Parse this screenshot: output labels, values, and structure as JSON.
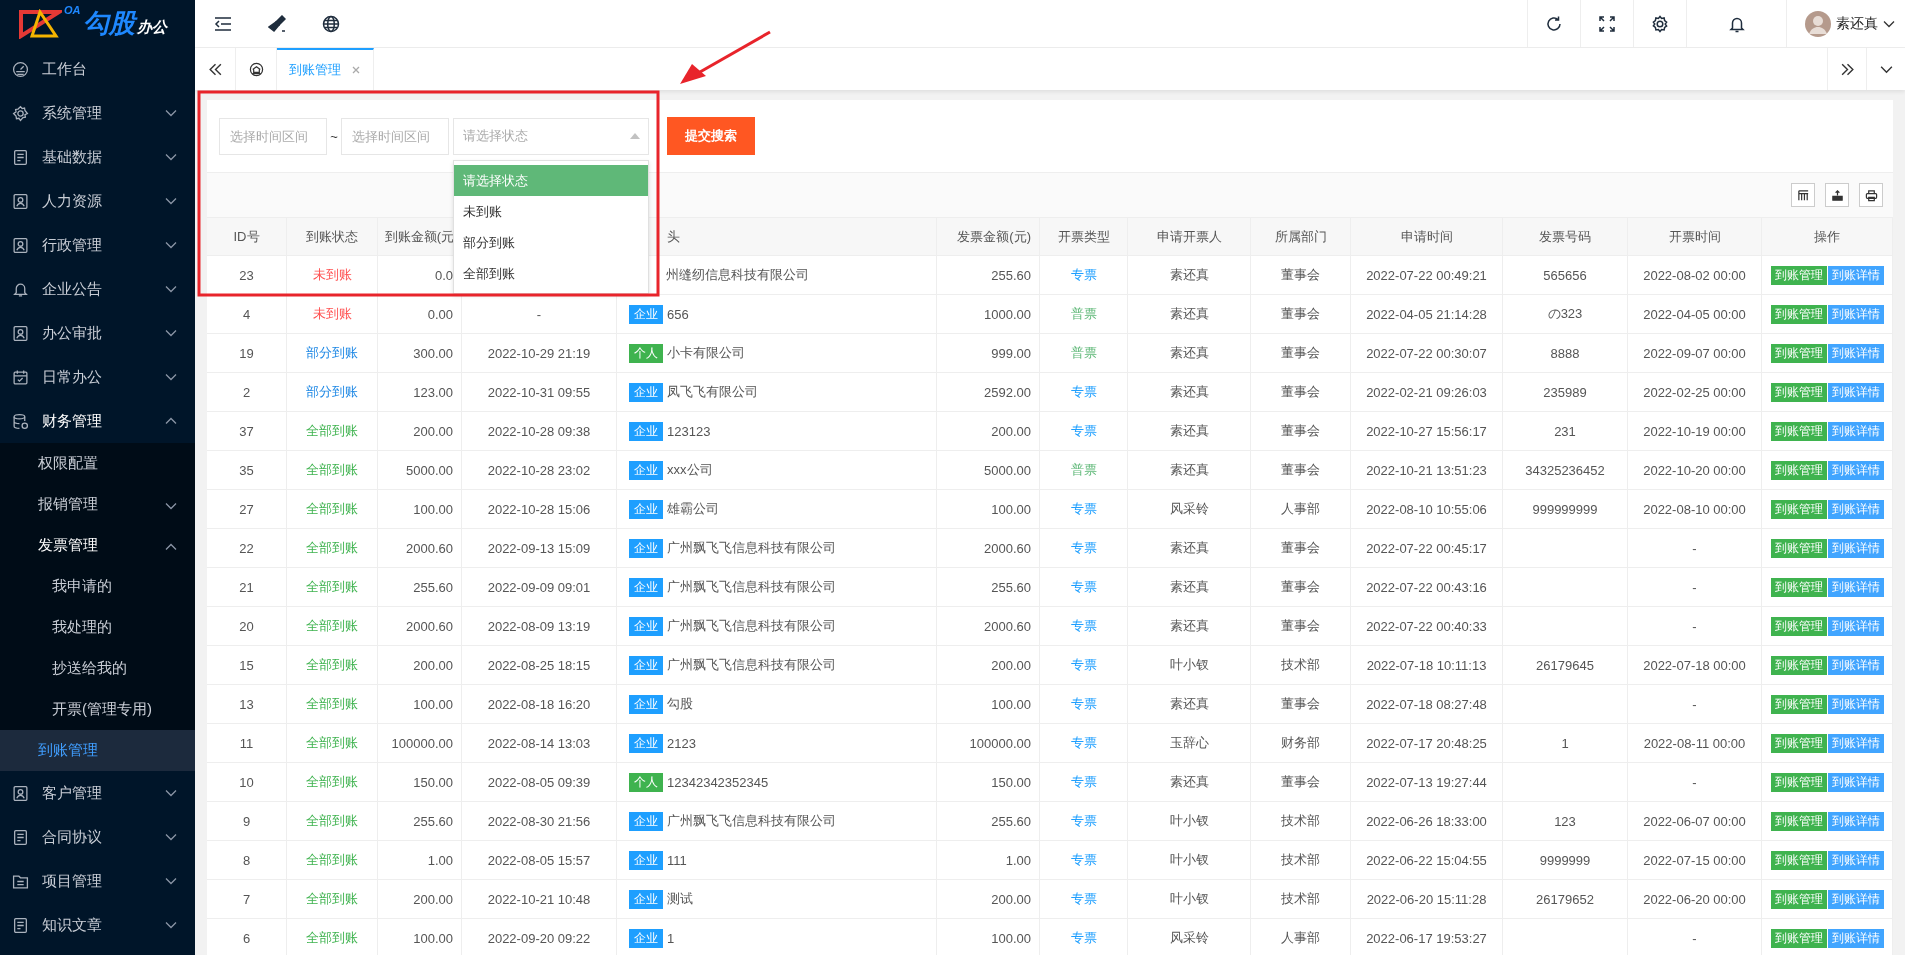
{
  "sidebar": {
    "logo": {
      "badge": "OA",
      "name": "勾股",
      "suffix": "办公"
    },
    "items": [
      {
        "label": "工作台",
        "selected": false
      },
      {
        "label": "系统管理",
        "selected": false,
        "expanded": false
      },
      {
        "label": "基础数据",
        "selected": false,
        "expanded": false
      },
      {
        "label": "人力资源",
        "selected": false,
        "expanded": false
      },
      {
        "label": "行政管理",
        "selected": false,
        "expanded": false
      },
      {
        "label": "企业公告",
        "selected": false,
        "expanded": false
      },
      {
        "label": "办公审批",
        "selected": false,
        "expanded": false
      },
      {
        "label": "日常办公",
        "selected": false,
        "expanded": false
      },
      {
        "label": "财务管理",
        "selected": false,
        "expanded": true,
        "children": [
          {
            "label": "权限配置",
            "selected": false
          },
          {
            "label": "报销管理",
            "selected": false,
            "expanded": false
          },
          {
            "label": "发票管理",
            "selected": false,
            "expanded": true,
            "children": [
              {
                "label": "我申请的",
                "selected": false
              },
              {
                "label": "我处理的",
                "selected": false
              },
              {
                "label": "抄送给我的",
                "selected": false
              },
              {
                "label": "开票(管理专用)",
                "selected": false
              }
            ]
          },
          {
            "label": "到账管理",
            "selected": true
          }
        ]
      },
      {
        "label": "客户管理",
        "selected": false,
        "expanded": false
      },
      {
        "label": "合同协议",
        "selected": false,
        "expanded": false
      },
      {
        "label": "项目管理",
        "selected": false,
        "expanded": false
      },
      {
        "label": "知识文章",
        "selected": false,
        "expanded": false
      }
    ]
  },
  "header": {
    "user": "素还真"
  },
  "tabs": [
    {
      "label": "到账管理",
      "selected": true
    }
  ],
  "search": {
    "start_placeholder": "选择时间区间",
    "separator": "~",
    "end_placeholder": "选择时间区间",
    "status_placeholder": "请选择状态",
    "submit": "提交搜索",
    "options": [
      {
        "label": "请选择状态",
        "selected": true
      },
      {
        "label": "未到账",
        "selected": false
      },
      {
        "label": "部分到账",
        "selected": false
      },
      {
        "label": "全部到账",
        "selected": false
      }
    ]
  },
  "table": {
    "columns_left": [
      "ID号",
      "到账状态",
      "到账金额(元"
    ],
    "columns_right": [
      "头",
      "发票金额(元)",
      "开票类型",
      "申请开票人",
      "所属部门",
      "申请时间",
      "发票号码",
      "开票时间",
      "操作"
    ],
    "rows": [
      {
        "id": "23",
        "status": {
          "text": "未到账",
          "color": "#ff5252"
        },
        "amount": "0.0",
        "title": "州缝纫信息科技有限公司",
        "invoice_amount": "255.60",
        "invoice_type": {
          "text": "专票",
          "color": "#1e9fff"
        },
        "applicant": "素还真",
        "department": "董事会",
        "apply_time": "2022-07-22 00:49:21",
        "invoice_no": "565656",
        "invoice_time": "2022-08-02 00:00",
        "actions": [
          "到账管理",
          "到账详情"
        ]
      },
      {
        "id": "4",
        "status": {
          "text": "未到账",
          "color": "#ff5252"
        },
        "amount": "0.00",
        "arrival_time": "-",
        "tag": {
          "text": "企业",
          "color": "#1e9fff"
        },
        "title": "656",
        "invoice_amount": "1000.00",
        "invoice_type": {
          "text": "普票",
          "color": "#5fb878"
        },
        "applicant": "素还真",
        "department": "董事会",
        "apply_time": "2022-04-05 21:14:28",
        "invoice_no": "の323",
        "invoice_time": "2022-04-05 00:00",
        "actions": [
          "到账管理",
          "到账详情"
        ]
      },
      {
        "id": "19",
        "status": {
          "text": "部分到账",
          "color": "#1e88e5"
        },
        "amount": "300.00",
        "arrival_time": "2022-10-29 21:19",
        "tag": {
          "text": "个人",
          "color": "#3fb34f"
        },
        "title": "小卡有限公司",
        "invoice_amount": "999.00",
        "invoice_type": {
          "text": "普票",
          "color": "#5fb878"
        },
        "applicant": "素还真",
        "department": "董事会",
        "apply_time": "2022-07-22 00:30:07",
        "invoice_no": "8888",
        "invoice_time": "2022-09-07 00:00",
        "actions": [
          "到账管理",
          "到账详情"
        ]
      },
      {
        "id": "2",
        "status": {
          "text": "部分到账",
          "color": "#1e88e5"
        },
        "amount": "123.00",
        "arrival_time": "2022-10-31 09:55",
        "tag": {
          "text": "企业",
          "color": "#1e9fff"
        },
        "title": "凤飞飞有限公司",
        "invoice_amount": "2592.00",
        "invoice_type": {
          "text": "专票",
          "color": "#1e9fff"
        },
        "applicant": "素还真",
        "department": "董事会",
        "apply_time": "2022-02-21 09:26:03",
        "invoice_no": "235989",
        "invoice_time": "2022-02-25 00:00",
        "actions": [
          "到账管理",
          "到账详情"
        ]
      },
      {
        "id": "37",
        "status": {
          "text": "全部到账",
          "color": "#3fb34f"
        },
        "amount": "200.00",
        "arrival_time": "2022-10-28 09:38",
        "tag": {
          "text": "企业",
          "color": "#1e9fff"
        },
        "title": "123123",
        "invoice_amount": "200.00",
        "invoice_type": {
          "text": "专票",
          "color": "#1e9fff"
        },
        "applicant": "素还真",
        "department": "董事会",
        "apply_time": "2022-10-27 15:56:17",
        "invoice_no": "231",
        "invoice_time": "2022-10-19 00:00",
        "actions": [
          "到账管理",
          "到账详情"
        ]
      },
      {
        "id": "35",
        "status": {
          "text": "全部到账",
          "color": "#3fb34f"
        },
        "amount": "5000.00",
        "arrival_time": "2022-10-28 23:02",
        "tag": {
          "text": "企业",
          "color": "#1e9fff"
        },
        "title": "xxx公司",
        "invoice_amount": "5000.00",
        "invoice_type": {
          "text": "普票",
          "color": "#5fb878"
        },
        "applicant": "素还真",
        "department": "董事会",
        "apply_time": "2022-10-21 13:51:23",
        "invoice_no": "34325236452",
        "invoice_time": "2022-10-20 00:00",
        "actions": [
          "到账管理",
          "到账详情"
        ]
      },
      {
        "id": "27",
        "status": {
          "text": "全部到账",
          "color": "#3fb34f"
        },
        "amount": "100.00",
        "arrival_time": "2022-10-28 15:06",
        "tag": {
          "text": "企业",
          "color": "#1e9fff"
        },
        "title": "雄霸公司",
        "invoice_amount": "100.00",
        "invoice_type": {
          "text": "专票",
          "color": "#1e9fff"
        },
        "applicant": "风采铃",
        "department": "人事部",
        "apply_time": "2022-08-10 10:55:06",
        "invoice_no": "999999999",
        "invoice_time": "2022-08-10 00:00",
        "actions": [
          "到账管理",
          "到账详情"
        ]
      },
      {
        "id": "22",
        "status": {
          "text": "全部到账",
          "color": "#3fb34f"
        },
        "amount": "2000.60",
        "arrival_time": "2022-09-13 15:09",
        "tag": {
          "text": "企业",
          "color": "#1e9fff"
        },
        "title": "广州飘飞飞信息科技有限公司",
        "invoice_amount": "2000.60",
        "invoice_type": {
          "text": "专票",
          "color": "#1e9fff"
        },
        "applicant": "素还真",
        "department": "董事会",
        "apply_time": "2022-07-22 00:45:17",
        "invoice_time": "-",
        "actions": [
          "到账管理",
          "到账详情"
        ]
      },
      {
        "id": "21",
        "status": {
          "text": "全部到账",
          "color": "#3fb34f"
        },
        "amount": "255.60",
        "arrival_time": "2022-09-09 09:01",
        "tag": {
          "text": "企业",
          "color": "#1e9fff"
        },
        "title": "广州飘飞飞信息科技有限公司",
        "invoice_amount": "255.60",
        "invoice_type": {
          "text": "专票",
          "color": "#1e9fff"
        },
        "applicant": "素还真",
        "department": "董事会",
        "apply_time": "2022-07-22 00:43:16",
        "invoice_time": "-",
        "actions": [
          "到账管理",
          "到账详情"
        ]
      },
      {
        "id": "20",
        "status": {
          "text": "全部到账",
          "color": "#3fb34f"
        },
        "amount": "2000.60",
        "arrival_time": "2022-08-09 13:19",
        "tag": {
          "text": "企业",
          "color": "#1e9fff"
        },
        "title": "广州飘飞飞信息科技有限公司",
        "invoice_amount": "2000.60",
        "invoice_type": {
          "text": "专票",
          "color": "#1e9fff"
        },
        "applicant": "素还真",
        "department": "董事会",
        "apply_time": "2022-07-22 00:40:33",
        "invoice_time": "-",
        "actions": [
          "到账管理",
          "到账详情"
        ]
      },
      {
        "id": "15",
        "status": {
          "text": "全部到账",
          "color": "#3fb34f"
        },
        "amount": "200.00",
        "arrival_time": "2022-08-25 18:15",
        "tag": {
          "text": "企业",
          "color": "#1e9fff"
        },
        "title": "广州飘飞飞信息科技有限公司",
        "invoice_amount": "200.00",
        "invoice_type": {
          "text": "专票",
          "color": "#1e9fff"
        },
        "applicant": "叶小钗",
        "department": "技术部",
        "apply_time": "2022-07-18 10:11:13",
        "invoice_no": "26179645",
        "invoice_time": "2022-07-18 00:00",
        "actions": [
          "到账管理",
          "到账详情"
        ]
      },
      {
        "id": "13",
        "status": {
          "text": "全部到账",
          "color": "#3fb34f"
        },
        "amount": "100.00",
        "arrival_time": "2022-08-18 16:20",
        "tag": {
          "text": "企业",
          "color": "#1e9fff"
        },
        "title": "勾股",
        "invoice_amount": "100.00",
        "invoice_type": {
          "text": "专票",
          "color": "#1e9fff"
        },
        "applicant": "素还真",
        "department": "董事会",
        "apply_time": "2022-07-18 08:27:48",
        "invoice_time": "-",
        "actions": [
          "到账管理",
          "到账详情"
        ]
      },
      {
        "id": "11",
        "status": {
          "text": "全部到账",
          "color": "#3fb34f"
        },
        "amount": "100000.00",
        "arrival_time": "2022-08-14 13:03",
        "tag": {
          "text": "企业",
          "color": "#1e9fff"
        },
        "title": "2123",
        "invoice_amount": "100000.00",
        "invoice_type": {
          "text": "专票",
          "color": "#1e9fff"
        },
        "applicant": "玉辞心",
        "department": "财务部",
        "apply_time": "2022-07-17 20:48:25",
        "invoice_no": "1",
        "invoice_time": "2022-08-11 00:00",
        "actions": [
          "到账管理",
          "到账详情"
        ]
      },
      {
        "id": "10",
        "status": {
          "text": "全部到账",
          "color": "#3fb34f"
        },
        "amount": "150.00",
        "arrival_time": "2022-08-05 09:39",
        "tag": {
          "text": "个人",
          "color": "#3fb34f"
        },
        "title": "12342342352345",
        "invoice_amount": "150.00",
        "invoice_type": {
          "text": "专票",
          "color": "#1e9fff"
        },
        "applicant": "素还真",
        "department": "董事会",
        "apply_time": "2022-07-13 19:27:44",
        "invoice_time": "-",
        "actions": [
          "到账管理",
          "到账详情"
        ]
      },
      {
        "id": "9",
        "status": {
          "text": "全部到账",
          "color": "#3fb34f"
        },
        "amount": "255.60",
        "arrival_time": "2022-08-30 21:56",
        "tag": {
          "text": "企业",
          "color": "#1e9fff"
        },
        "title": "广州飘飞飞信息科技有限公司",
        "invoice_amount": "255.60",
        "invoice_type": {
          "text": "专票",
          "color": "#1e9fff"
        },
        "applicant": "叶小钗",
        "department": "技术部",
        "apply_time": "2022-06-26 18:33:00",
        "invoice_no": "123",
        "invoice_time": "2022-06-07 00:00",
        "actions": [
          "到账管理",
          "到账详情"
        ]
      },
      {
        "id": "8",
        "status": {
          "text": "全部到账",
          "color": "#3fb34f"
        },
        "amount": "1.00",
        "arrival_time": "2022-08-05 15:57",
        "tag": {
          "text": "企业",
          "color": "#1e9fff"
        },
        "title": "111",
        "invoice_amount": "1.00",
        "invoice_type": {
          "text": "专票",
          "color": "#1e9fff"
        },
        "applicant": "叶小钗",
        "department": "技术部",
        "apply_time": "2022-06-22 15:04:55",
        "invoice_no": "9999999",
        "invoice_time": "2022-07-15 00:00",
        "actions": [
          "到账管理",
          "到账详情"
        ]
      },
      {
        "id": "7",
        "status": {
          "text": "全部到账",
          "color": "#3fb34f"
        },
        "amount": "200.00",
        "arrival_time": "2022-10-21 10:48",
        "tag": {
          "text": "企业",
          "color": "#1e9fff"
        },
        "title": "测试",
        "invoice_amount": "200.00",
        "invoice_type": {
          "text": "专票",
          "color": "#1e9fff"
        },
        "applicant": "叶小钗",
        "department": "技术部",
        "apply_time": "2022-06-20 15:11:28",
        "invoice_no": "26179652",
        "invoice_time": "2022-06-20 00:00",
        "actions": [
          "到账管理",
          "到账详情"
        ]
      },
      {
        "id": "6",
        "status": {
          "text": "全部到账",
          "color": "#3fb34f"
        },
        "amount": "100.00",
        "arrival_time": "2022-09-20 09:22",
        "tag": {
          "text": "企业",
          "color": "#1e9fff"
        },
        "title": "1",
        "invoice_amount": "100.00",
        "invoice_type": {
          "text": "专票",
          "color": "#1e9fff"
        },
        "applicant": "风采铃",
        "department": "人事部",
        "apply_time": "2022-06-17 19:53:27",
        "invoice_time": "-",
        "actions": [
          "到账管理",
          "到账详情"
        ]
      }
    ]
  }
}
